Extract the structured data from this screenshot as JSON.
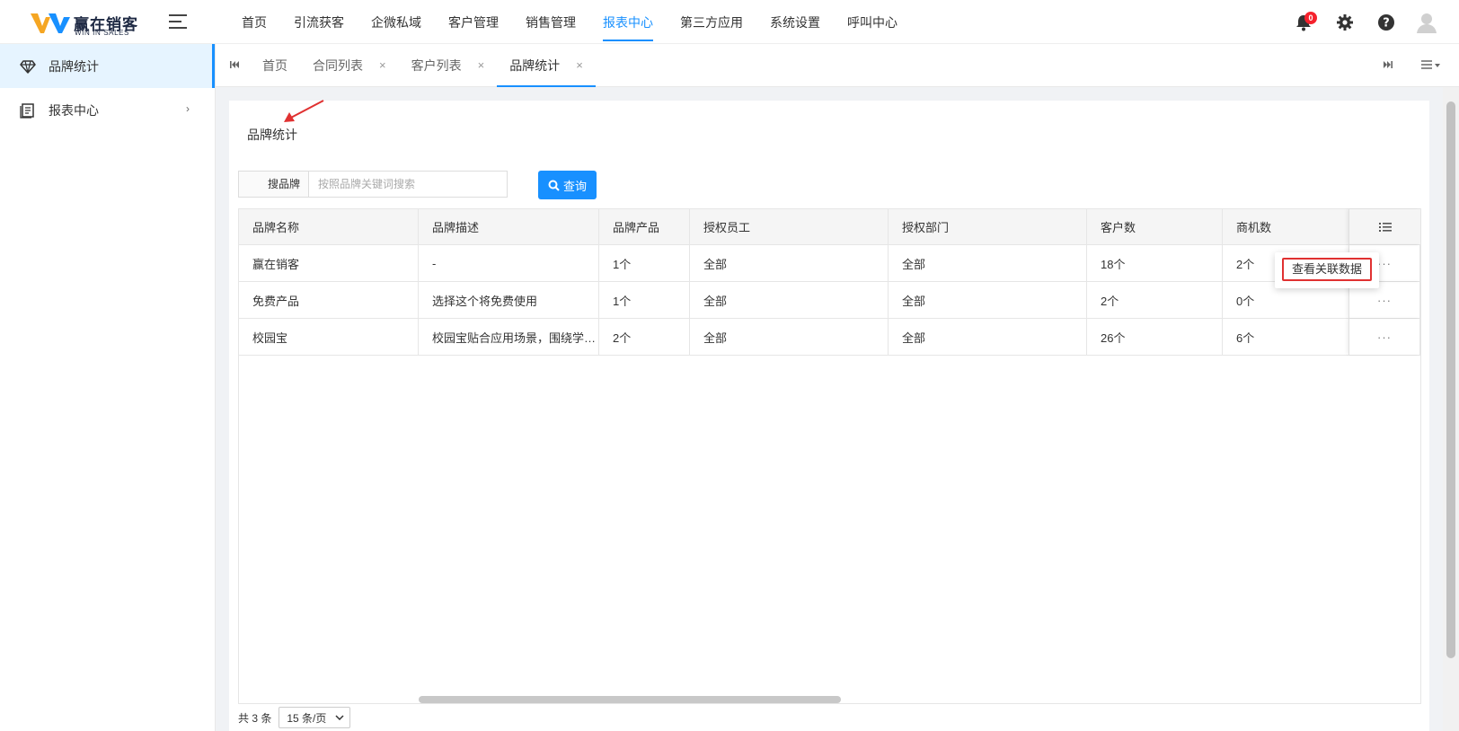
{
  "header": {
    "logo_cn": "赢在销客",
    "logo_en": "WIN IN SALES",
    "nav": [
      {
        "label": "首页"
      },
      {
        "label": "引流获客"
      },
      {
        "label": "企微私域"
      },
      {
        "label": "客户管理"
      },
      {
        "label": "销售管理"
      },
      {
        "label": "报表中心",
        "active": true
      },
      {
        "label": "第三方应用"
      },
      {
        "label": "系统设置"
      },
      {
        "label": "呼叫中心"
      }
    ],
    "notification_count": "0",
    "icons": [
      "moon-icon",
      "bell-icon",
      "gear-icon",
      "help-icon",
      "avatar"
    ]
  },
  "sidebar": {
    "items": [
      {
        "label": "品牌统计",
        "icon": "diamond-icon",
        "active": true
      },
      {
        "label": "报表中心",
        "icon": "book-icon"
      }
    ]
  },
  "tabs": [
    {
      "label": "首页",
      "closable": false
    },
    {
      "label": "合同列表",
      "closable": true
    },
    {
      "label": "客户列表",
      "closable": true
    },
    {
      "label": "品牌统计",
      "closable": true,
      "active": true
    }
  ],
  "page": {
    "title": "品牌统计"
  },
  "search": {
    "label": "搜品牌",
    "placeholder": "按照品牌关键词搜索",
    "button": "查询"
  },
  "table": {
    "columns": [
      "品牌名称",
      "品牌描述",
      "品牌产品",
      "授权员工",
      "授权部门",
      "客户数",
      "商机数"
    ],
    "rows": [
      [
        "赢在销客",
        "-",
        "1个",
        "全部",
        "全部",
        "18个",
        "2个"
      ],
      [
        "免费产品",
        "选择这个将免费使用",
        "1个",
        "全部",
        "全部",
        "2个",
        "0个"
      ],
      [
        "校园宝",
        "校园宝贴合应用场景，围绕学校招生宣传",
        "2个",
        "全部",
        "全部",
        "26个",
        "6个"
      ]
    ],
    "row_action": "···"
  },
  "popup": {
    "label": "查看关联数据"
  },
  "footer": {
    "total": "共 3 条",
    "page_size": "15 条/页"
  },
  "colors": {
    "accent": "#1890ff",
    "highlight_border": "#e03131",
    "badge": "#f5222d"
  }
}
